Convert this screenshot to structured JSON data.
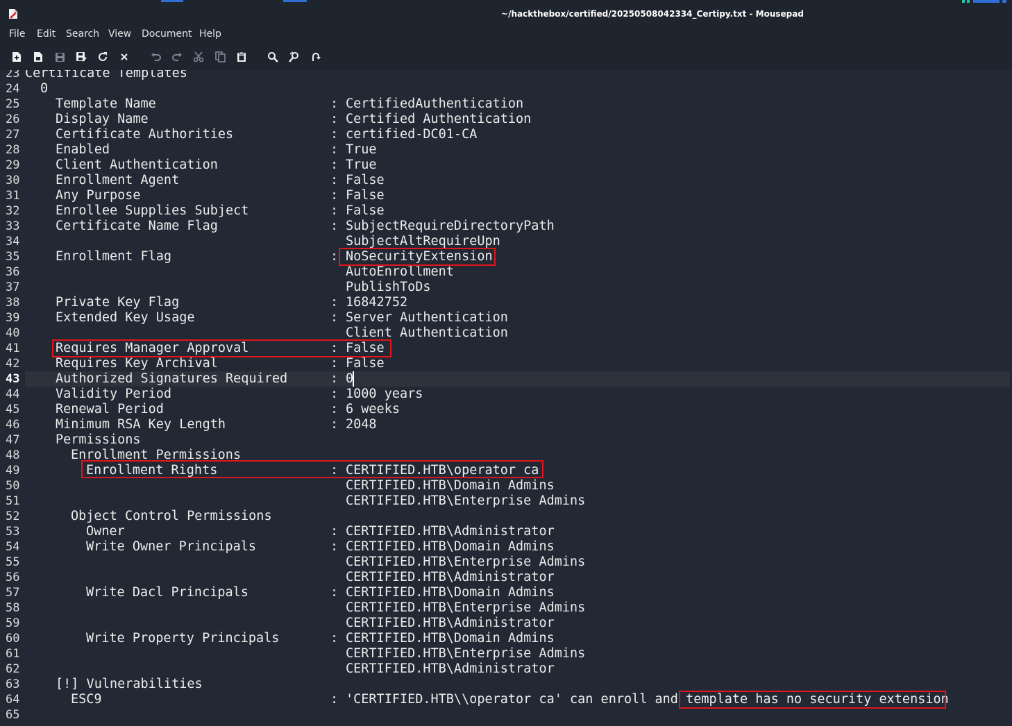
{
  "window": {
    "title": "~/hackthebox/certified/20250508042334_Certipy.txt - Mousepad"
  },
  "menu": [
    "File",
    "Edit",
    "Search",
    "View",
    "Document",
    "Help"
  ],
  "toolbar": {
    "icons": [
      "new-document-icon",
      "new-window-icon",
      "save-icon",
      "save-as-icon",
      "reload-icon",
      "close-icon",
      "undo-icon",
      "redo-icon",
      "cut-icon",
      "copy-icon",
      "paste-icon",
      "find-icon",
      "find-replace-icon",
      "go-to-line-icon"
    ]
  },
  "editor": {
    "current_line": 43,
    "lines": [
      {
        "n": "23",
        "key": "Certificate Templates",
        "indent": 0
      },
      {
        "n": "24",
        "key": "0",
        "indent": 1
      },
      {
        "n": "25",
        "key": "Template Name",
        "val": "CertifiedAuthentication",
        "indent": 2
      },
      {
        "n": "26",
        "key": "Display Name",
        "val": "Certified Authentication",
        "indent": 2
      },
      {
        "n": "27",
        "key": "Certificate Authorities",
        "val": "certified-DC01-CA",
        "indent": 2
      },
      {
        "n": "28",
        "key": "Enabled",
        "val": "True",
        "indent": 2
      },
      {
        "n": "29",
        "key": "Client Authentication",
        "val": "True",
        "indent": 2
      },
      {
        "n": "30",
        "key": "Enrollment Agent",
        "val": "False",
        "indent": 2
      },
      {
        "n": "31",
        "key": "Any Purpose",
        "val": "False",
        "indent": 2
      },
      {
        "n": "32",
        "key": "Enrollee Supplies Subject",
        "val": "False",
        "indent": 2
      },
      {
        "n": "33",
        "key": "Certificate Name Flag",
        "val": "SubjectRequireDirectoryPath",
        "indent": 2
      },
      {
        "n": "34",
        "val": "SubjectAltRequireUpn"
      },
      {
        "n": "35",
        "key": "Enrollment Flag",
        "val": "NoSecurityExtension",
        "indent": 2
      },
      {
        "n": "36",
        "val": "AutoEnrollment"
      },
      {
        "n": "37",
        "val": "PublishToDs"
      },
      {
        "n": "38",
        "key": "Private Key Flag",
        "val": "16842752",
        "indent": 2
      },
      {
        "n": "39",
        "key": "Extended Key Usage",
        "val": "Server Authentication",
        "indent": 2
      },
      {
        "n": "40",
        "val": "Client Authentication"
      },
      {
        "n": "41",
        "key": "Requires Manager Approval",
        "val": "False",
        "indent": 2
      },
      {
        "n": "42",
        "key": "Requires Key Archival",
        "val": "False",
        "indent": 2
      },
      {
        "n": "43",
        "key": "Authorized Signatures Required",
        "val": "0",
        "indent": 2
      },
      {
        "n": "44",
        "key": "Validity Period",
        "val": "1000 years",
        "indent": 2
      },
      {
        "n": "45",
        "key": "Renewal Period",
        "val": "6 weeks",
        "indent": 2
      },
      {
        "n": "46",
        "key": "Minimum RSA Key Length",
        "val": "2048",
        "indent": 2
      },
      {
        "n": "47",
        "key": "Permissions",
        "indent": 2
      },
      {
        "n": "48",
        "key": "Enrollment Permissions",
        "indent": 3
      },
      {
        "n": "49",
        "key": "Enrollment Rights",
        "val": "CERTIFIED.HTB\\operator ca",
        "indent": 4
      },
      {
        "n": "50",
        "val": "CERTIFIED.HTB\\Domain Admins"
      },
      {
        "n": "51",
        "val": "CERTIFIED.HTB\\Enterprise Admins"
      },
      {
        "n": "52",
        "key": "Object Control Permissions",
        "indent": 3
      },
      {
        "n": "53",
        "key": "Owner",
        "val": "CERTIFIED.HTB\\Administrator",
        "indent": 4
      },
      {
        "n": "54",
        "key": "Write Owner Principals",
        "val": "CERTIFIED.HTB\\Domain Admins",
        "indent": 4
      },
      {
        "n": "55",
        "val": "CERTIFIED.HTB\\Enterprise Admins"
      },
      {
        "n": "56",
        "val": "CERTIFIED.HTB\\Administrator"
      },
      {
        "n": "57",
        "key": "Write Dacl Principals",
        "val": "CERTIFIED.HTB\\Domain Admins",
        "indent": 4
      },
      {
        "n": "58",
        "val": "CERTIFIED.HTB\\Enterprise Admins"
      },
      {
        "n": "59",
        "val": "CERTIFIED.HTB\\Administrator"
      },
      {
        "n": "60",
        "key": "Write Property Principals",
        "val": "CERTIFIED.HTB\\Domain Admins",
        "indent": 4
      },
      {
        "n": "61",
        "val": "CERTIFIED.HTB\\Enterprise Admins"
      },
      {
        "n": "62",
        "val": "CERTIFIED.HTB\\Administrator"
      },
      {
        "n": "63",
        "key": "[!] Vulnerabilities",
        "indent": 2
      },
      {
        "n": "64",
        "key": "ESC9",
        "val": "'CERTIFIED.HTB\\\\operator ca' can enroll and template has no security extension",
        "indent": 3
      },
      {
        "n": "65"
      }
    ]
  },
  "colors": {
    "background": "#222834",
    "chrome": "#1f252f",
    "highlight_box": "#e0161b",
    "current_line": "#2d323c"
  }
}
